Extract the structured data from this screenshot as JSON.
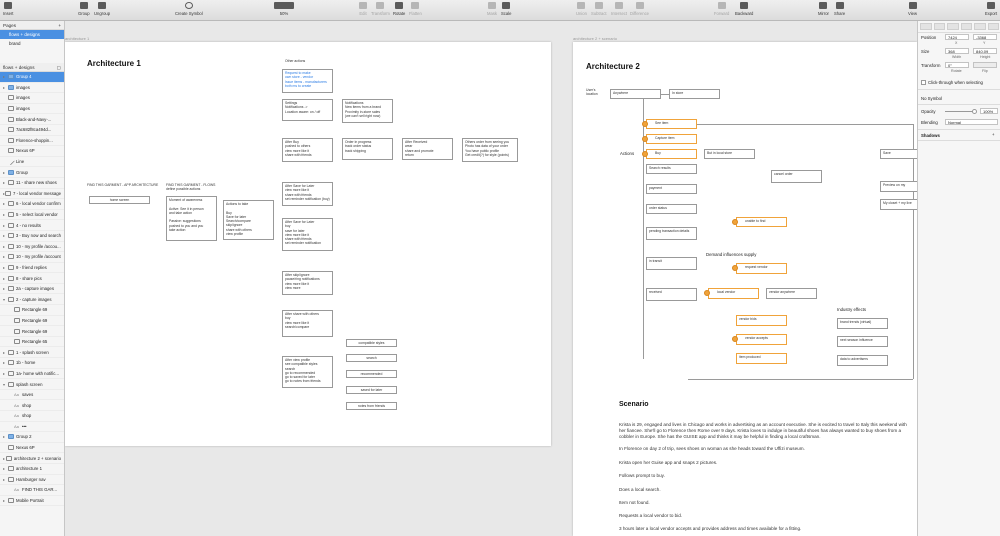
{
  "toolbar": {
    "insert": "Insert",
    "group": "Group",
    "ungroup": "Ungroup",
    "create_symbol": "Create Symbol",
    "zoom": "50%",
    "edit": "Edit",
    "transform": "Transform",
    "rotate": "Rotate",
    "flatten": "Flatten",
    "mask": "Mask",
    "scale": "Scale",
    "union": "Union",
    "subtract": "Subtract",
    "intersect": "Intersect",
    "difference": "Difference",
    "forward": "Forward",
    "backward": "Backward",
    "mirror": "Mirror",
    "share": "Share",
    "view": "View",
    "export": "Export"
  },
  "pages": {
    "header": "Pages",
    "items": [
      "flows + designs",
      "brand"
    ]
  },
  "layers": {
    "header": "flows + designs",
    "items": [
      {
        "label": "Group 4",
        "icon": "folder",
        "arrow": "▸",
        "selected": true
      },
      {
        "label": "images",
        "icon": "folder",
        "arrow": "▸"
      },
      {
        "label": "images",
        "icon": "image",
        "arrow": ""
      },
      {
        "label": "images",
        "icon": "image",
        "arrow": ""
      },
      {
        "label": "Black-and-Navy-...",
        "icon": "image",
        "arrow": ""
      },
      {
        "label": "7ac682f8ca494d...",
        "icon": "image",
        "arrow": ""
      },
      {
        "label": "Florence-shoppin...",
        "icon": "image",
        "arrow": ""
      },
      {
        "label": "Nexus 6P",
        "icon": "image",
        "arrow": ""
      },
      {
        "label": "Line",
        "icon": "line",
        "arrow": ""
      },
      {
        "label": "Group",
        "icon": "folder",
        "arrow": "▸"
      },
      {
        "label": "11 - share new shoes",
        "icon": "artboard",
        "arrow": "▸"
      },
      {
        "label": "7 - local vendor message",
        "icon": "artboard",
        "arrow": "▸"
      },
      {
        "label": "6 - local vendor confirm",
        "icon": "artboard",
        "arrow": "▸"
      },
      {
        "label": "5 - select local vendor",
        "icon": "artboard",
        "arrow": "▸"
      },
      {
        "label": "4 - no results",
        "icon": "artboard",
        "arrow": "▸"
      },
      {
        "label": "3 - Buy now and search",
        "icon": "artboard",
        "arrow": "▸"
      },
      {
        "label": "10 - my profile /accou...",
        "icon": "artboard",
        "arrow": "▸"
      },
      {
        "label": "10 - my profile /account",
        "icon": "artboard",
        "arrow": "▸"
      },
      {
        "label": "9 - friend replies",
        "icon": "artboard",
        "arrow": "▸"
      },
      {
        "label": "8 - share pics",
        "icon": "artboard",
        "arrow": "▸"
      },
      {
        "label": "2a - capture images",
        "icon": "artboard",
        "arrow": "▸"
      },
      {
        "label": "2 - capture images",
        "icon": "artboard",
        "arrow": "▾"
      },
      {
        "label": "Rectangle 69",
        "icon": "rect",
        "arrow": ""
      },
      {
        "label": "Rectangle 69",
        "icon": "rect",
        "arrow": ""
      },
      {
        "label": "Rectangle 69",
        "icon": "rect",
        "arrow": ""
      },
      {
        "label": "Rectangle 65",
        "icon": "rect",
        "arrow": ""
      },
      {
        "label": "1 - splash screen",
        "icon": "artboard",
        "arrow": "▸"
      },
      {
        "label": "1b - home",
        "icon": "artboard",
        "arrow": "▸"
      },
      {
        "label": "1a- home with notific...",
        "icon": "artboard",
        "arrow": "▸"
      },
      {
        "label": "splash screen",
        "icon": "artboard",
        "arrow": "▾"
      },
      {
        "label": "saves",
        "icon": "text",
        "arrow": ""
      },
      {
        "label": "shop",
        "icon": "text",
        "arrow": ""
      },
      {
        "label": "shop",
        "icon": "text",
        "arrow": ""
      },
      {
        "label": "•••",
        "icon": "text",
        "arrow": ""
      },
      {
        "label": "Group 2",
        "icon": "folder",
        "arrow": "▸"
      },
      {
        "label": "Nexus 6P",
        "icon": "image",
        "arrow": ""
      },
      {
        "label": "architecture 2 + scenario",
        "icon": "artboard",
        "arrow": "▸"
      },
      {
        "label": "architecture 1",
        "icon": "artboard",
        "arrow": "▸"
      },
      {
        "label": "Hamburger nav",
        "icon": "artboard",
        "arrow": "▸"
      },
      {
        "label": "FIND THIS GAR...",
        "icon": "text",
        "arrow": ""
      },
      {
        "label": "Mobile Portrait",
        "icon": "artboard",
        "arrow": "▸"
      }
    ]
  },
  "canvas": {
    "artboard1_label": "architecture 1",
    "artboard2_label": "architecture 2 + scenario"
  },
  "arch1": {
    "title": "Architecture 1",
    "other_actions": "Other actions",
    "request_link": "Request to make\nown store - vendor\nIssue items - manufacturers\nboth ms to create",
    "settings": "Settings\nNotifications ->\nLocation aware: on / off",
    "notifications": "Notifications\nNew items from a brand\nProximity in-store sales\n(we can't sell right now)",
    "after_buy": "After Buy\npushed to others\nview more like it\nshare with friends",
    "order_progress": "Order in progress\ntrack order status\ntrack shipping",
    "after_received": "After Received\nwear\nshare and promote\nreturn",
    "others_order": "Others order from seeing you\nPhoto has data of your order\nYou have public profile\nGet credit(?) for style (points)",
    "after_save_1": "After Save for Later\nview more like it\nshare with friends\nset reminder notification (buy)",
    "after_save_2": "After Save for Later\nbuy\nsave for later\nview more like it\nshare with friends\nset reminder notification",
    "after_skip": "After skip/ignore\npause/ring notifications\nview more like it\nview more",
    "after_share": "After share with others\nbuy\nview more like it\nsearch/compare",
    "after_profile": "After view profile\nsee compatible styles\nsearch\ngo to recommended\ngo to saved for later\ngo to notes from friends",
    "find_app": "FIND THIS GARMENT - APP ARCHITECTURE",
    "find_flows": "FIND THIS GARMENT - FLOWS\ndefine possible actions",
    "home_screen": "home screen",
    "moment": "Moment of awareness\n\nActive: See it in person\nand take action\n\nPassive: suggestions\npushed to you and you\ntake action",
    "actions_take": "Actions to take\n\nBuy\nSave for later\nSearch/compare\nskip/ignore\nshare with others\nview profile",
    "compatible": "compatible styles",
    "search": "search",
    "recommended": "recommended",
    "saved": "saved for later",
    "notes": "notes from friends"
  },
  "arch2": {
    "title": "Architecture 2",
    "users_location": "User's\nlocation",
    "anywhere": "Anywhere",
    "in_store": "In store",
    "see_item": "See item",
    "capture_item": "Capture item",
    "actions": "Actions",
    "buy": "Buy",
    "but_local": "But in local store",
    "search_results": "Search results",
    "cancel_order": "cancel order",
    "payment": "payment",
    "order_status": "order status",
    "unable_find": "unable to find",
    "pending": "pending transaction details",
    "in_transit": "in transit",
    "demand": "Demand influences supply",
    "request_vendor": "request vendor",
    "received": "received",
    "local_vendor": "local vendor",
    "vendor_anywhere": "vendor anywhere",
    "vendor_bids": "vendor bids",
    "industry": "Industry effects",
    "brand_trends": "brand trends (virtual)",
    "next_season": "next season influence",
    "vendor_accepts": "vendor accepts",
    "data_adv": "data to advertisers",
    "item_produced": "item produced",
    "save": "Save",
    "preview": "Preview on my",
    "my_closet": "My closet + my live",
    "scenario_title": "Scenario",
    "scenario_p1": "Krista is 29, engaged and lives in Chicago and works in advertising as an account executive. She is excited to travel to Italy this weekend with her fiancee. She'll go to Florence then Rome over 9 days. Krista loves to indulge in beautiful shoes has always wanted to buy shoes from a cobbler in Europe. She has the GUISE app and thinks it may be helpful in finding a local craftsman.",
    "scenario_p2": "In Florence on day 2 of trip, sees shoes on woman as she heads toward the Uffizi museum.",
    "scenario_p3": "Krista open her Guise app and snaps 2 pictures.",
    "scenario_p4": "Follows prompt to buy.",
    "scenario_p5": "Does a local search.",
    "scenario_p6": "Item not found.",
    "scenario_p7": "Requests a local vendor to bid.",
    "scenario_p8": "3 hours later a local vendor accepts and provides address and times available for a fitting."
  },
  "inspector": {
    "position": "Position",
    "x": "7424",
    "y": "-3368",
    "x_lab": "X",
    "y_lab": "Y",
    "size": "Size",
    "width": "368",
    "height": "840.09",
    "w_lab": "Width",
    "h_lab": "Height",
    "transform": "Transform",
    "rotate": "0°",
    "rotate_lab": "Rotate",
    "flip_lab": "Flip",
    "click_through": "Click-through when selecting",
    "no_symbol": "No Symbol",
    "opacity": "Opacity",
    "opacity_val": "100%",
    "blending": "Blending",
    "blending_val": "Normal",
    "shadows": "Shadows"
  }
}
